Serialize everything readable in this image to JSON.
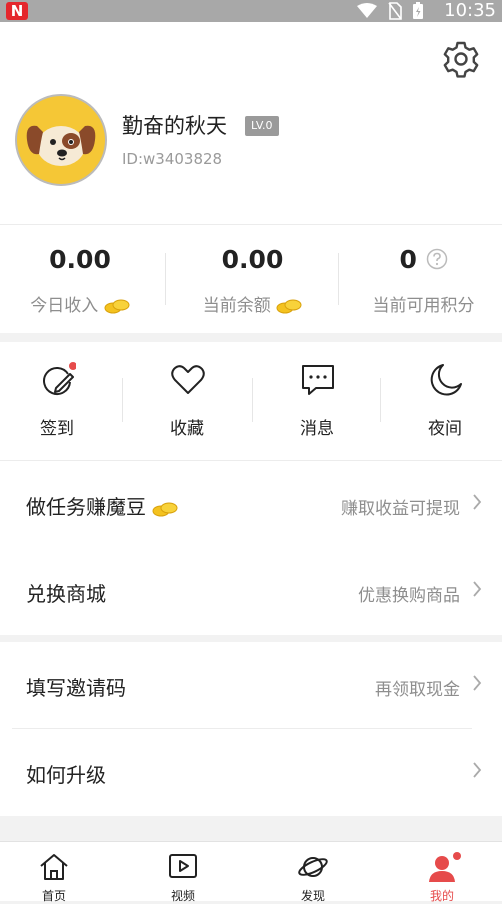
{
  "status_bar": {
    "app_badge": "N",
    "time": "10:35"
  },
  "profile": {
    "username": "勤奋的秋天",
    "level": "LV.0",
    "user_id": "ID:w3403828"
  },
  "stats": [
    {
      "value": "0.00",
      "label": "今日收入"
    },
    {
      "value": "0.00",
      "label": "当前余额"
    },
    {
      "value": "0",
      "label": "当前可用积分"
    }
  ],
  "quick_actions": [
    {
      "label": "签到",
      "icon": "checkin-pen-icon"
    },
    {
      "label": "收藏",
      "icon": "heart-icon"
    },
    {
      "label": "消息",
      "icon": "message-icon"
    },
    {
      "label": "夜间",
      "icon": "moon-icon"
    }
  ],
  "menu": [
    {
      "title": "做任务赚魔豆",
      "subtitle": "赚取收益可提现"
    },
    {
      "title": "兑换商城",
      "subtitle": "优惠换购商品"
    },
    {
      "title": "填写邀请码",
      "subtitle": "再领取现金"
    },
    {
      "title": "如何升级",
      "subtitle": ""
    }
  ],
  "tabs": [
    {
      "label": "首页",
      "icon": "home-icon"
    },
    {
      "label": "视频",
      "icon": "video-icon"
    },
    {
      "label": "发现",
      "icon": "planet-icon"
    },
    {
      "label": "我的",
      "icon": "person-icon"
    }
  ],
  "colors": {
    "accent": "#e64b4b",
    "coin": "#f4c21f",
    "avatar_bg": "#f5c736"
  }
}
